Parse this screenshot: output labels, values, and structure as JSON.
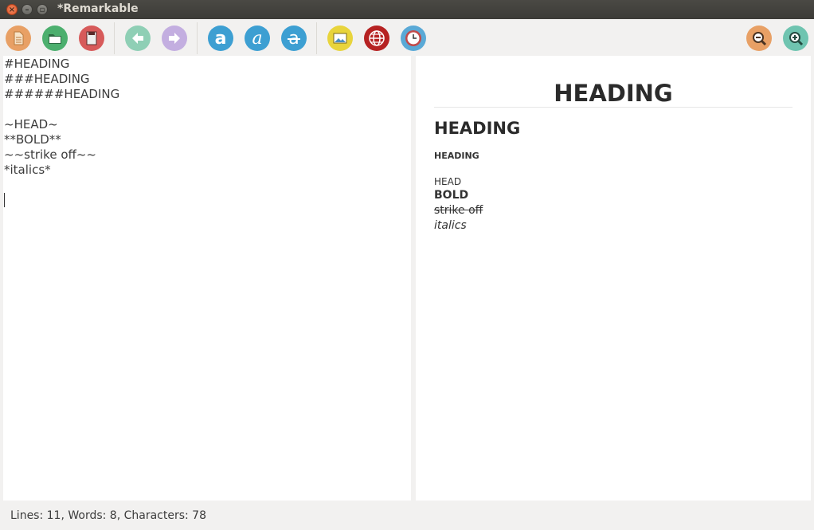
{
  "window": {
    "title": "*Remarkable",
    "close_glyph": "×",
    "minimize_glyph": "–",
    "maximize_glyph": "▫"
  },
  "toolbar": {
    "buttons": [
      {
        "icon": "new-document-icon",
        "color": "#e8a065"
      },
      {
        "icon": "open-folder-icon",
        "color": "#4caf6e"
      },
      {
        "icon": "save-icon",
        "color": "#d75a5a"
      },
      {
        "icon": "undo-arrow-icon",
        "color": "#8fcfb5"
      },
      {
        "icon": "redo-arrow-icon",
        "color": "#c3aee0"
      },
      {
        "icon": "bold-text-icon",
        "color": "#3d9fd2"
      },
      {
        "icon": "italic-text-icon",
        "color": "#3d9fd2"
      },
      {
        "icon": "strikethrough-text-icon",
        "color": "#3d9fd2"
      },
      {
        "icon": "insert-image-icon",
        "color": "#e8d43c"
      },
      {
        "icon": "insert-link-icon",
        "color": "#b62222"
      },
      {
        "icon": "insert-timestamp-icon",
        "color": "#5aa9d6"
      },
      {
        "icon": "zoom-out-icon",
        "color": "#e8a065"
      },
      {
        "icon": "zoom-in-icon",
        "color": "#6fc4b0"
      }
    ]
  },
  "editor": {
    "lines": [
      "#HEADING",
      "###HEADING",
      "######HEADING",
      "",
      "~HEAD~",
      "**BOLD**",
      "~~strike off~~",
      "*italics*",
      "",
      "",
      ""
    ]
  },
  "preview": {
    "h1": "HEADING",
    "h3": "HEADING",
    "h6": "HEADING",
    "subscript": "HEAD",
    "bold": "BOLD",
    "strike": "strike off",
    "italic": "italics"
  },
  "status": {
    "text": "Lines: 11, Words: 8, Characters: 78"
  }
}
